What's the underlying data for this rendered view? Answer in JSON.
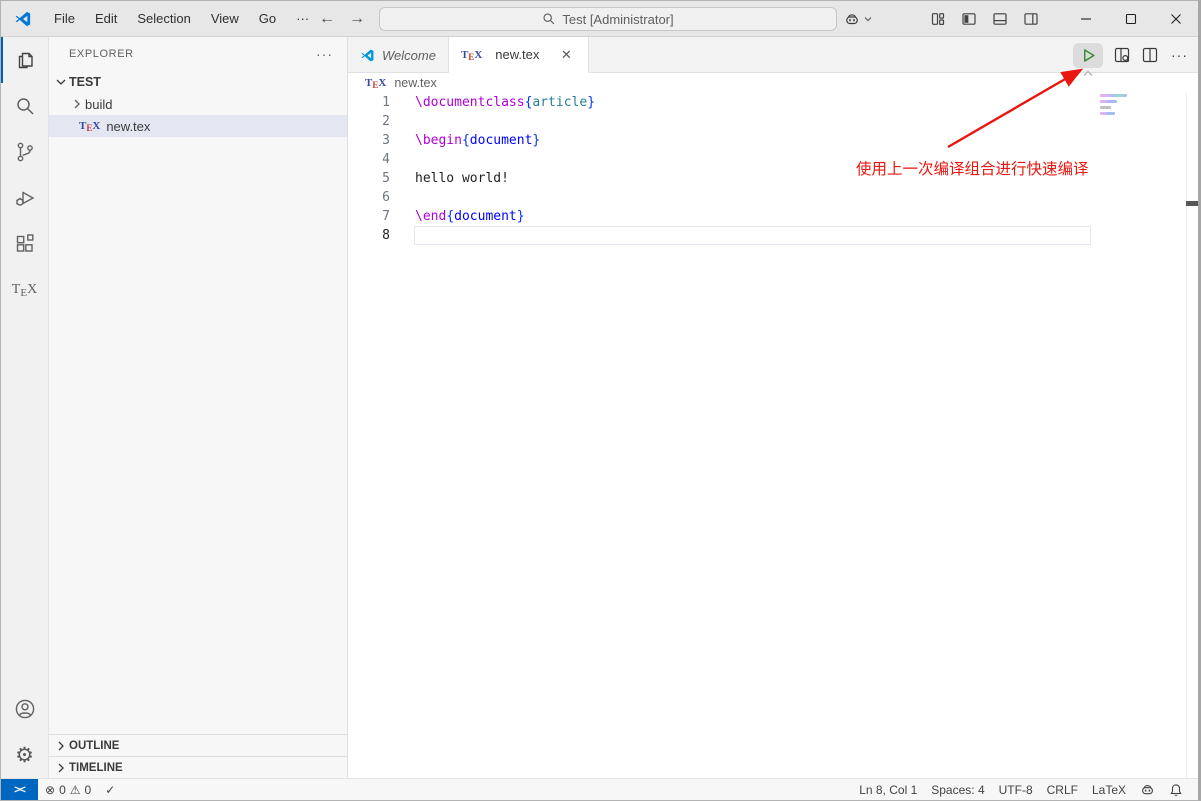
{
  "titlebar": {
    "menus": [
      "File",
      "Edit",
      "Selection",
      "View",
      "Go"
    ],
    "menu_more": "···",
    "search_text": "Test [Administrator]"
  },
  "activity_bar": {
    "tex_label_t": "T",
    "tex_label_e": "E",
    "tex_label_x": "X"
  },
  "sidebar": {
    "header": "EXPLORER",
    "header_more": "···",
    "root": "TEST",
    "files": [
      {
        "name": "build"
      },
      {
        "name": "new.tex"
      }
    ],
    "outline": "OUTLINE",
    "timeline": "TIMELINE"
  },
  "tabs": [
    {
      "label": "Welcome"
    },
    {
      "label": "new.tex"
    }
  ],
  "editor_actions": {
    "more": "···"
  },
  "breadcrumb": {
    "file": "new.tex"
  },
  "tex_icon": {
    "t": "T",
    "e": "E",
    "x": "X"
  },
  "editor": {
    "lines": [
      {
        "num": "1",
        "tokens": [
          {
            "t": "\\documentclass",
            "c": "cmd"
          },
          {
            "t": "{",
            "c": "brace"
          },
          {
            "t": "article",
            "c": "cls"
          },
          {
            "t": "}",
            "c": "brace"
          }
        ]
      },
      {
        "num": "2",
        "tokens": []
      },
      {
        "num": "3",
        "tokens": [
          {
            "t": "\\begin",
            "c": "cmd"
          },
          {
            "t": "{",
            "c": "brace"
          },
          {
            "t": "document",
            "c": "env"
          },
          {
            "t": "}",
            "c": "brace"
          }
        ]
      },
      {
        "num": "4",
        "tokens": []
      },
      {
        "num": "5",
        "tokens": [
          {
            "t": "hello world!",
            "c": "text"
          }
        ]
      },
      {
        "num": "6",
        "tokens": []
      },
      {
        "num": "7",
        "tokens": [
          {
            "t": "\\end",
            "c": "cmd"
          },
          {
            "t": "{",
            "c": "brace"
          },
          {
            "t": "document",
            "c": "env"
          },
          {
            "t": "}",
            "c": "brace"
          }
        ]
      },
      {
        "num": "8",
        "tokens": []
      }
    ]
  },
  "annotation": {
    "text": "使用上一次编译组合进行快速编译"
  },
  "statusbar": {
    "errors": "0",
    "warnings": "0",
    "line_col": "Ln 8, Col 1",
    "spaces": "Spaces: 4",
    "encoding": "UTF-8",
    "eol": "CRLF",
    "language": "LaTeX"
  },
  "colors": {
    "accent_blue": "#005fb8",
    "remote_badge_blue": "#0067c0",
    "annotation_red": "#e8160f",
    "play_green": "#388a34",
    "cmd_purple": "#af00db",
    "brace_blue": "#0431fa",
    "class_teal": "#267f99",
    "env_blue": "#0000ff",
    "selected_item_bg": "#e4e6f1"
  }
}
